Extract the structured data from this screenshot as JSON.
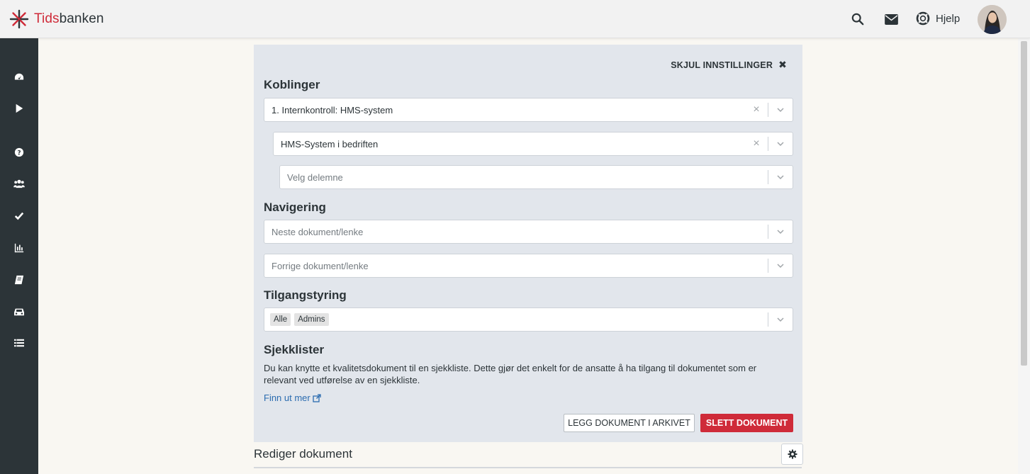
{
  "brand": {
    "name_accent": "Tids",
    "name_rest": "banken"
  },
  "header": {
    "help_label": "Hjelp"
  },
  "settings": {
    "hide_label": "SKJUL INNSTILLINGER",
    "koblinger": {
      "title": "Koblinger",
      "select1_value": "1. Internkontroll: HMS-system",
      "select2_value": "HMS-System i bedriften",
      "select3_placeholder": "Velg delemne"
    },
    "navigering": {
      "title": "Navigering",
      "next_placeholder": "Neste dokument/lenke",
      "prev_placeholder": "Forrige dokument/lenke"
    },
    "tilgang": {
      "title": "Tilgangstyring",
      "chips": [
        "Alle",
        "Admins"
      ]
    },
    "sjekklister": {
      "title": "Sjekklister",
      "description": "Du kan knytte et kvalitetsdokument til en sjekkliste. Dette gjør det enkelt for de ansatte å ha tilgang til dokumentet som er relevant ved utførelse av en sjekkliste.",
      "link_label": "Finn ut mer"
    },
    "buttons": {
      "archive_label": "LEGG DOKUMENT I ARKIVET",
      "delete_label": "SLETT DOKUMENT"
    }
  },
  "editor": {
    "title": "Rediger dokument"
  },
  "colors": {
    "accent": "#cf2b39",
    "sidebar": "#2c3438",
    "panel": "#e2e6ec",
    "link": "#2b6cb0"
  }
}
